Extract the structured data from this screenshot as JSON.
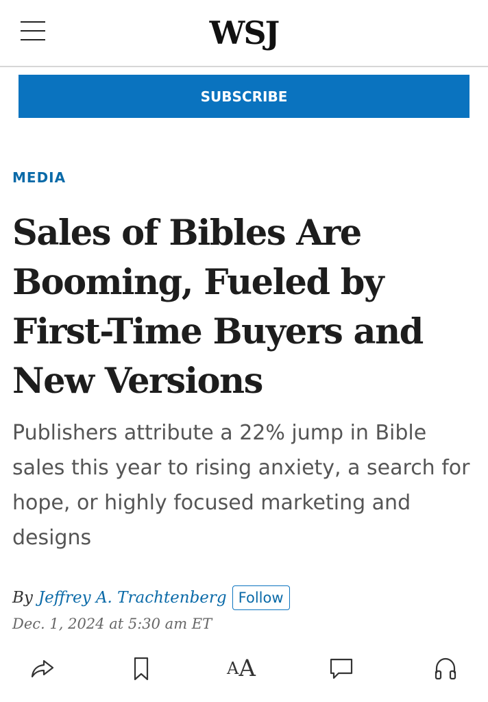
{
  "header": {
    "logo": "WSJ",
    "menu_icon": "hamburger-menu-icon"
  },
  "subscribe": {
    "label": "SUBSCRIBE",
    "color": "#0a73bf"
  },
  "article": {
    "section": "MEDIA",
    "headline": "Sales of Bibles Are Booming, Fueled by First-Time Buyers and New Versions",
    "dek": "Publishers attribute a 22% jump in Bible sales this year to rising anxiety, a search for hope, or highly focused marketing and designs",
    "byline_prefix": "By",
    "author": "Jeffrey A. Trachtenberg",
    "follow_label": "Follow",
    "date": "Dec. 1, 2024 at 5:30 am ET"
  },
  "action_bar": {
    "icons": [
      "share-icon",
      "bookmark-icon",
      "text-size-icon",
      "comment-icon",
      "listen-icon"
    ],
    "text_size_small": "A",
    "text_size_big": "A"
  },
  "colors": {
    "accent": "#0a73bf",
    "link": "#0a6aa8",
    "headline": "#1d1d1d",
    "dek": "#555555"
  }
}
